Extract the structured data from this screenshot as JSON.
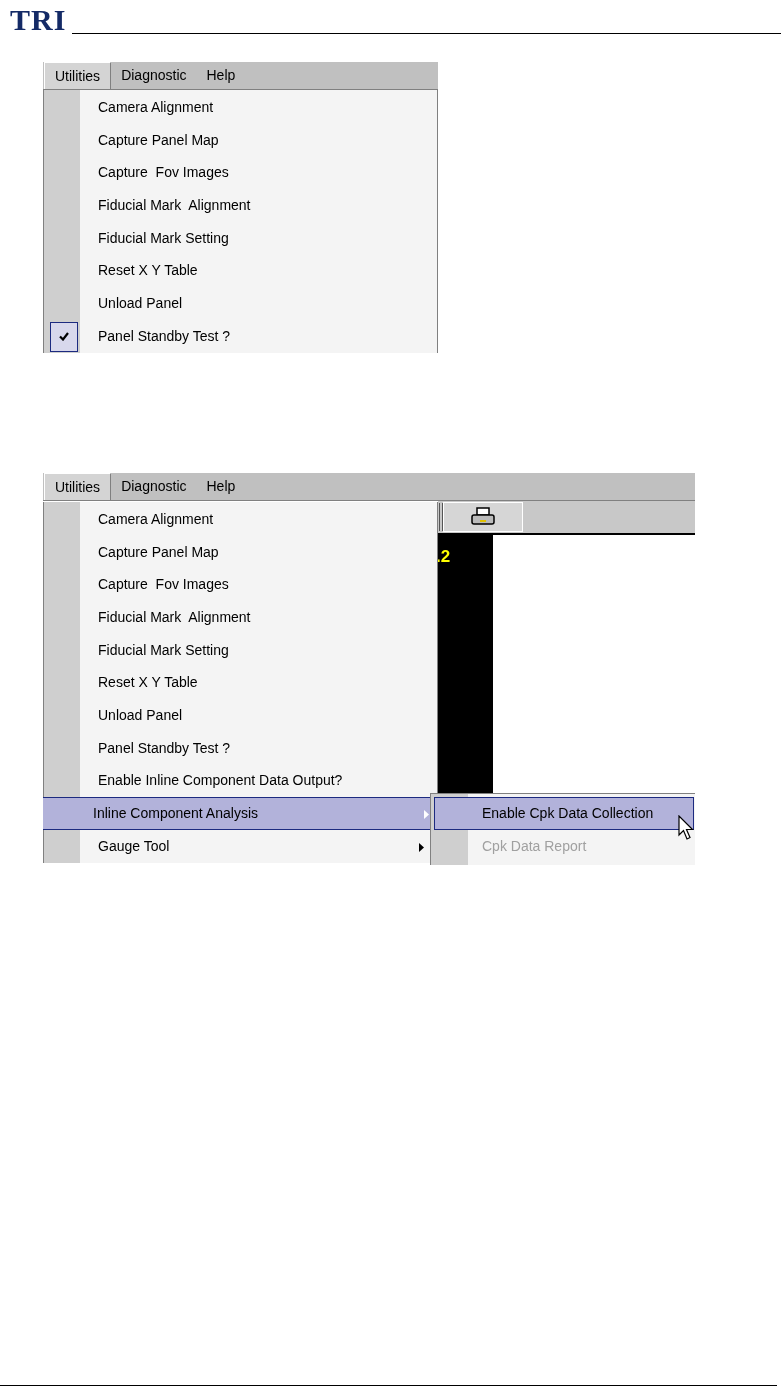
{
  "header": {
    "logo": "TRI"
  },
  "screenshots": [
    {
      "menu_bar": [
        {
          "label": "Utilities",
          "selected": true
        },
        {
          "label": "Diagnostic",
          "selected": false
        },
        {
          "label": "Help",
          "selected": false
        }
      ],
      "menu_items": [
        {
          "label": "Camera Alignment",
          "checked": false,
          "selected": false,
          "has_submenu": false
        },
        {
          "label": "Capture Panel Map",
          "checked": false,
          "selected": false,
          "has_submenu": false
        },
        {
          "label": "Capture  Fov Images",
          "checked": false,
          "selected": false,
          "has_submenu": false
        },
        {
          "label": "Fiducial Mark  Alignment",
          "checked": false,
          "selected": false,
          "has_submenu": false
        },
        {
          "label": "Fiducial Mark Setting",
          "checked": false,
          "selected": false,
          "has_submenu": false
        },
        {
          "label": "Reset X Y Table",
          "checked": false,
          "selected": false,
          "has_submenu": false
        },
        {
          "label": "Unload Panel",
          "checked": false,
          "selected": false,
          "has_submenu": false
        },
        {
          "label": "Panel Standby Test ?",
          "checked": true,
          "selected": false,
          "has_submenu": false
        }
      ]
    },
    {
      "menu_bar": [
        {
          "label": "Utilities",
          "selected": true
        },
        {
          "label": "Diagnostic",
          "selected": false
        },
        {
          "label": "Help",
          "selected": false
        }
      ],
      "background": {
        "readout": ".2"
      },
      "menu_items": [
        {
          "label": "Camera Alignment",
          "checked": false,
          "selected": false,
          "has_submenu": false
        },
        {
          "label": "Capture Panel Map",
          "checked": false,
          "selected": false,
          "has_submenu": false
        },
        {
          "label": "Capture  Fov Images",
          "checked": false,
          "selected": false,
          "has_submenu": false
        },
        {
          "label": "Fiducial Mark  Alignment",
          "checked": false,
          "selected": false,
          "has_submenu": false
        },
        {
          "label": "Fiducial Mark Setting",
          "checked": false,
          "selected": false,
          "has_submenu": false
        },
        {
          "label": "Reset X Y Table",
          "checked": false,
          "selected": false,
          "has_submenu": false
        },
        {
          "label": "Unload Panel",
          "checked": false,
          "selected": false,
          "has_submenu": false
        },
        {
          "label": "Panel Standby Test ?",
          "checked": false,
          "selected": false,
          "has_submenu": false
        },
        {
          "label": "Enable Inline Component Data Output?",
          "checked": false,
          "selected": false,
          "has_submenu": false
        },
        {
          "label": "Inline Component Analysis",
          "checked": false,
          "selected": true,
          "has_submenu": true
        },
        {
          "label": "Gauge Tool",
          "checked": false,
          "selected": false,
          "has_submenu": true
        }
      ],
      "submenu": [
        {
          "label": "Enable Cpk Data Collection",
          "selected": true,
          "disabled": false
        },
        {
          "label": "Cpk Data Report",
          "selected": false,
          "disabled": true
        }
      ]
    }
  ]
}
